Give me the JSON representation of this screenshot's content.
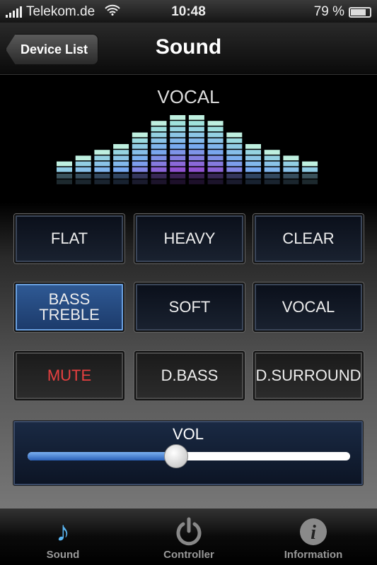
{
  "status_bar": {
    "carrier": "Telekom.de",
    "time": "10:48",
    "battery": "79 %",
    "battery_level": 0.79
  },
  "nav": {
    "back_label": "Device List",
    "title": "Sound"
  },
  "equalizer": {
    "preset": "VOCAL",
    "levels": [
      2,
      3,
      4,
      5,
      7,
      9,
      10,
      10,
      9,
      7,
      5,
      4,
      3,
      2
    ]
  },
  "presets": [
    {
      "label": "FLAT",
      "state": "normal"
    },
    {
      "label": "HEAVY",
      "state": "normal"
    },
    {
      "label": "CLEAR",
      "state": "normal"
    },
    {
      "label": "BASS\nTREBLE",
      "state": "selected"
    },
    {
      "label": "SOFT",
      "state": "normal"
    },
    {
      "label": "VOCAL",
      "state": "normal"
    },
    {
      "label": "MUTE",
      "state": "off"
    },
    {
      "label": "D.BASS",
      "state": "off"
    },
    {
      "label": "D.SURROUND",
      "state": "off"
    }
  ],
  "volume": {
    "label": "VOL",
    "value": 0.46
  },
  "tabs": [
    {
      "label": "Sound",
      "icon": "music-note-icon",
      "active": true
    },
    {
      "label": "Controller",
      "icon": "power-icon",
      "active": false
    },
    {
      "label": "Information",
      "icon": "info-icon",
      "active": false
    }
  ],
  "colors": {
    "accent": "#3a70c8",
    "mute": "#e84040"
  }
}
